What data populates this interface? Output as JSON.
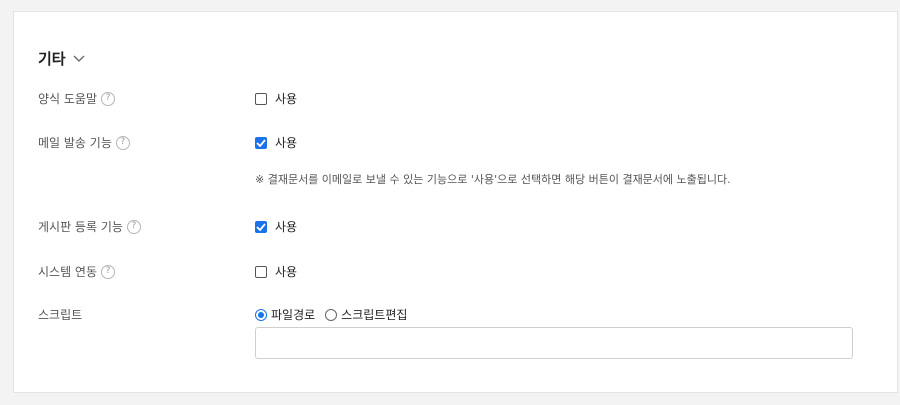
{
  "section": {
    "title": "기타"
  },
  "rows": {
    "form_help": {
      "label": "양식 도움말",
      "option_label": "사용",
      "checked": false
    },
    "mail_send": {
      "label": "메일 발송 기능",
      "option_label": "사용",
      "checked": true,
      "note": "※ 결재문서를 이메일로 보낼 수 있는 기능으로 '사용'으로 선택하면 해당 버튼이 결재문서에 노출됩니다."
    },
    "board_register": {
      "label": "게시판 등록 기능",
      "option_label": "사용",
      "checked": true
    },
    "system_link": {
      "label": "시스템 연동",
      "option_label": "사용",
      "checked": false
    },
    "script": {
      "label": "스크립트",
      "radio_file_path": "파일경로",
      "radio_script_edit": "스크립트편집",
      "selected": "파일경로",
      "input_value": ""
    }
  },
  "help_glyph": "?",
  "colors": {
    "accent": "#1a73e8"
  }
}
